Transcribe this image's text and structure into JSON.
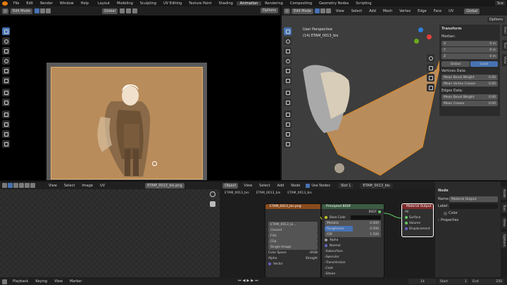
{
  "topbar": {
    "menus": [
      "File",
      "Edit",
      "Render",
      "Window",
      "Help"
    ],
    "workspaces": [
      "Layout",
      "Modeling",
      "Sculpting",
      "UV Editing",
      "Texture Paint",
      "Shading",
      "Animation",
      "Rendering",
      "Compositing",
      "Geometry Nodes",
      "Scripting"
    ],
    "active_workspace": "Animation",
    "scene": "Sce"
  },
  "left_view": {
    "mode": "Edit Mode",
    "transform": "Global",
    "options": "Options"
  },
  "viewport3d": {
    "mode": "Edit Mode",
    "menus": [
      "View",
      "Select",
      "Add",
      "Mesh",
      "Vertex",
      "Edge",
      "Face",
      "UV"
    ],
    "transform": "Global",
    "options": "Options",
    "overlay_title": "User Perspective",
    "overlay_object": "(14) ETAM_0013_bis",
    "sidebar_tabs": [
      "Item",
      "Tool",
      "View"
    ]
  },
  "npanel": {
    "transform_label": "Transform",
    "median_label": "Median:",
    "x_label": "X",
    "x_value": "0 m",
    "y_label": "Y",
    "y_value": "0 m",
    "z_label": "Z",
    "z_value": "0 m",
    "global_btn": "Global",
    "local_btn": "Local",
    "vertices_data_label": "Vertices Data:",
    "mean_bevel_weight_v": "Mean Bevel Weight",
    "mean_bevel_weight_v_val": "0.00",
    "mean_vertex_crease": "Mean Vertex Crease",
    "mean_vertex_crease_val": "0.00",
    "edges_data_label": "Edges Data:",
    "mean_bevel_weight_e": "Mean Bevel Weight",
    "mean_bevel_weight_e_val": "0.00",
    "mean_crease": "Mean Crease",
    "mean_crease_val": "0.00"
  },
  "image_editor": {
    "menus": [
      "View",
      "Select",
      "Image",
      "UV"
    ],
    "image_name": "ETAM_0013_bis.png"
  },
  "node_editor": {
    "type": "Object",
    "menus": [
      "View",
      "Select",
      "Add",
      "Node"
    ],
    "use_nodes": "Use Nodes",
    "slot": "Slot 1",
    "material": "ETAM_0013_bis",
    "breadcrumb": [
      "ETAM_0013_bis",
      "ETAM_0013_bis",
      "ETAM_0013_bis"
    ],
    "image_node": {
      "title": "ETAM_0013_bis.png",
      "image_field": "ETAM_0013_bi...",
      "rows": [
        "Closest",
        "Flat",
        "Clip",
        "Single Image"
      ],
      "color_space_label": "Color Space",
      "color_space": "sRGB",
      "alpha_label": "Alpha",
      "alpha": "Straight",
      "vector": "Vector"
    },
    "bsdf_node": {
      "title": "Principled BSDF",
      "output": "BSDF",
      "base_color": "Base Color",
      "metallic": "Metallic",
      "metallic_val": "0.000",
      "roughness": "Roughness",
      "roughness_val": "0.500",
      "ior": "IOR",
      "ior_val": "1.500",
      "alpha": "Alpha",
      "normal": "Normal",
      "sections": [
        "Subsurface",
        "Specular",
        "Transmission",
        "Coat",
        "Sheen"
      ]
    },
    "output_node": {
      "title": "Material Output",
      "target": "All",
      "inputs": [
        "Surface",
        "Volume",
        "Displacement"
      ]
    }
  },
  "node_sidebar": {
    "section": "Node",
    "name_label": "Name:",
    "name_value": "Material Output",
    "label_label": "Label:",
    "color_label": "Color",
    "properties_label": "Properties",
    "tabs": [
      "Node",
      "Tool",
      "View",
      "Options"
    ]
  },
  "timeline": {
    "menus": [
      "Playback",
      "Keying",
      "View",
      "Marker"
    ],
    "current_frame": "14",
    "start_label": "Start",
    "start": "1",
    "end_label": "End",
    "end": "250"
  },
  "colors": {
    "accent": "#4772b3",
    "image_bg": "#b98c5b",
    "bsdf_header": "#3b5c42",
    "image_node_header": "#8a4b1d",
    "output_header": "#7c2a2a"
  }
}
